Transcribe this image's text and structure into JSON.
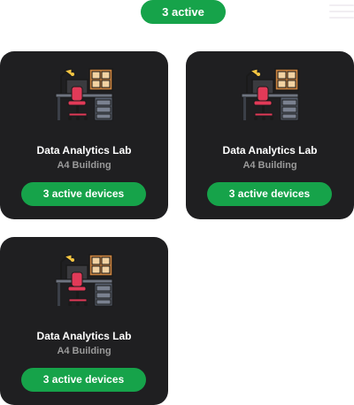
{
  "header": {
    "active_summary": "3 active"
  },
  "rooms": [
    {
      "name": "Data Analytics Lab",
      "building": "A4 Building",
      "status": "3 active devices",
      "icon": "workspace-desk-icon"
    },
    {
      "name": "Data Analytics Lab",
      "building": "A4 Building",
      "status": "3 active devices",
      "icon": "workspace-desk-icon"
    },
    {
      "name": "Data Analytics Lab",
      "building": "A4 Building",
      "status": "3 active devices",
      "icon": "workspace-desk-icon"
    }
  ],
  "colors": {
    "accent": "#16a34a",
    "card_bg": "#1f1f21",
    "title": "#ffffff",
    "subtitle": "#9a9a9a"
  }
}
